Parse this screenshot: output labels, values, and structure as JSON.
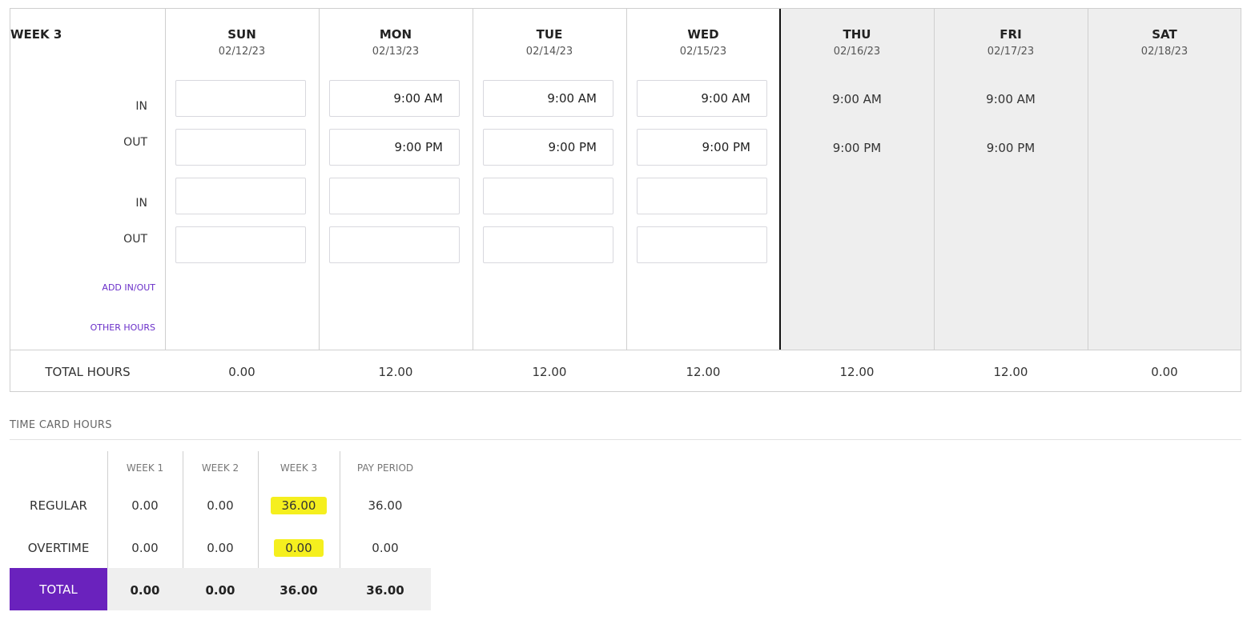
{
  "week": {
    "title": "WEEK 3",
    "labels": {
      "in1": "IN",
      "out1": "OUT",
      "in2": "IN",
      "out2": "OUT"
    },
    "links": {
      "add_in_out": "ADD IN/OUT",
      "other_hours": "OTHER HOURS"
    },
    "days": [
      {
        "name": "SUN",
        "date": "02/12/23",
        "in1": "",
        "out1": "",
        "in2": "",
        "out2": "",
        "total": "0.00"
      },
      {
        "name": "MON",
        "date": "02/13/23",
        "in1": "9:00 AM",
        "out1": "9:00 PM",
        "in2": "",
        "out2": "",
        "total": "12.00"
      },
      {
        "name": "TUE",
        "date": "02/14/23",
        "in1": "9:00 AM",
        "out1": "9:00 PM",
        "in2": "",
        "out2": "",
        "total": "12.00"
      },
      {
        "name": "WED",
        "date": "02/15/23",
        "in1": "9:00 AM",
        "out1": "9:00 PM",
        "in2": "",
        "out2": "",
        "total": "12.00"
      },
      {
        "name": "THU",
        "date": "02/16/23",
        "in1": "9:00 AM",
        "out1": "9:00 PM",
        "total": "12.00"
      },
      {
        "name": "FRI",
        "date": "02/17/23",
        "in1": "9:00 AM",
        "out1": "9:00 PM",
        "total": "12.00"
      },
      {
        "name": "SAT",
        "date": "02/18/23",
        "in1": "",
        "out1": "",
        "total": "0.00"
      }
    ],
    "total_label": "TOTAL HOURS"
  },
  "time_card": {
    "heading": "TIME CARD HOURS",
    "columns": [
      "WEEK 1",
      "WEEK 2",
      "WEEK 3",
      "PAY PERIOD"
    ],
    "rows": [
      {
        "label": "REGULAR",
        "values": [
          "0.00",
          "0.00",
          "36.00",
          "36.00"
        ]
      },
      {
        "label": "OVERTIME",
        "values": [
          "0.00",
          "0.00",
          "0.00",
          "0.00"
        ]
      }
    ],
    "total": {
      "label": "TOTAL",
      "values": [
        "0.00",
        "0.00",
        "36.00",
        "36.00"
      ]
    },
    "highlight_color": "#f5ef1e",
    "total_label_color": "#6a22bd"
  },
  "colors": {
    "link": "#6a2fc9",
    "locked_bg": "#eeeeee"
  }
}
